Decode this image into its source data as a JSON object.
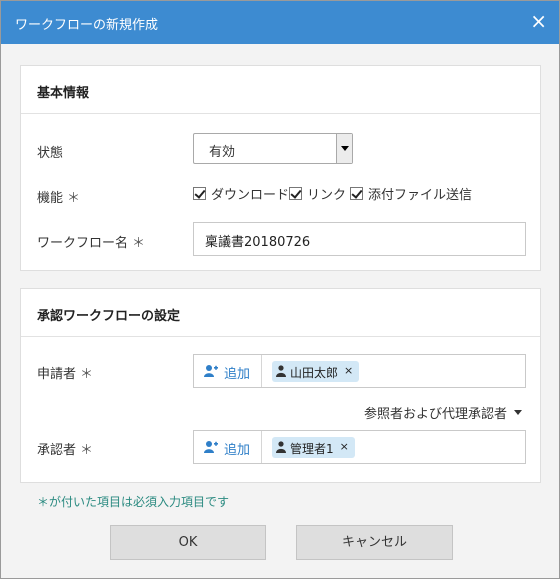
{
  "dialog": {
    "title": "ワークフローの新規作成",
    "close": "×"
  },
  "basic": {
    "heading": "基本情報",
    "status_label": "状態",
    "status_value": "有効",
    "function_label": "機能",
    "required_mark": "＊",
    "functions": [
      {
        "label": "ダウンロード",
        "checked": true
      },
      {
        "label": "リンク",
        "checked": true
      },
      {
        "label": "添付ファイル送信",
        "checked": true
      }
    ],
    "name_label": "ワークフロー名",
    "name_value": "稟議書20180726"
  },
  "approval": {
    "heading": "承認ワークフローの設定",
    "applicant_label": "申請者",
    "add_label": "追加",
    "applicant_tag": "山田太郎",
    "tag_remove": "×",
    "reference_link": "参照者および代理承認者",
    "approver_label": "承認者",
    "approver_tag": "管理者1"
  },
  "note": "＊が付いた項目は必須入力項目です",
  "buttons": {
    "ok": "OK",
    "cancel": "キャンセル"
  },
  "colors": {
    "titlebar": "#3d8bd1",
    "accent": "#2f7fc8",
    "note": "#2a8a80",
    "tag": "#d3e8f6"
  }
}
